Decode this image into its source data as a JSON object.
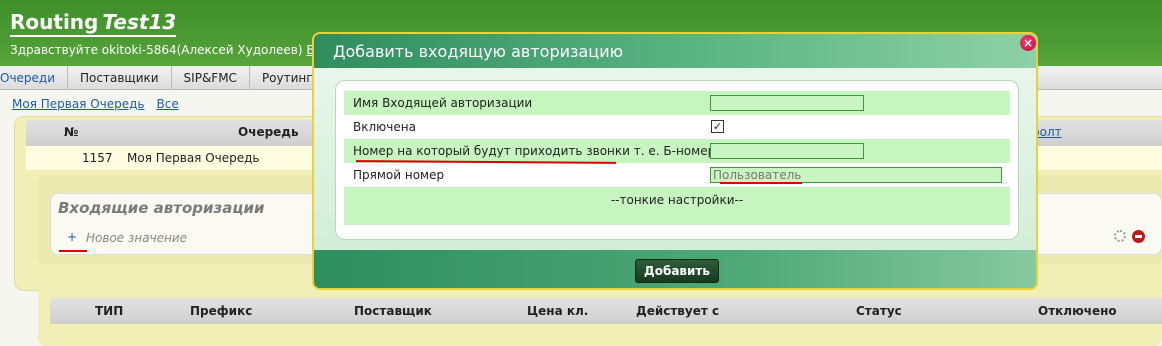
{
  "header": {
    "title": "Routing",
    "project": "Test13",
    "greeting": "Здравствуйте  okitoki-5864(Алексей Худолеев)",
    "exit": "Вы"
  },
  "nav": [
    "Очереди",
    "Поставщики",
    "SIP&FMC",
    "Роутинг"
  ],
  "sublinks": [
    "Моя Первая Очередь",
    "Все"
  ],
  "queue_table": {
    "headers": [
      "№",
      "Очередь"
    ],
    "default_link": "ефолт",
    "row": {
      "id": "1157",
      "name": "Моя Первая Очередь"
    }
  },
  "inbox": {
    "title": "Входящие авторизации",
    "plus": "+",
    "new_value": "Новое значение"
  },
  "bottom_table": {
    "headers": [
      "ТИП",
      "Префикс",
      "Поставщик",
      "Цена кл.",
      "Действует с",
      "Статус",
      "Отключено"
    ]
  },
  "modal": {
    "title": "Добавить входящую авторизацию",
    "close": "×",
    "fields": {
      "name_label": "Имя Входящей авторизации",
      "enabled_label": "Включена",
      "enabled_checked": "✓",
      "number_label": "Номер на который будут приходить звонки т. е. Б-номер",
      "direct_label": "Прямой номер",
      "direct_value": "Пользователь",
      "fine_settings": "--тонкие настройки--"
    },
    "submit": "Добавить"
  },
  "colors": {
    "header_green": "#4c9a33",
    "modal_green": "#4fa979",
    "modal_border": "#e7d23a",
    "annotation_red": "#dd0000",
    "link_blue": "#1c5ca8"
  }
}
